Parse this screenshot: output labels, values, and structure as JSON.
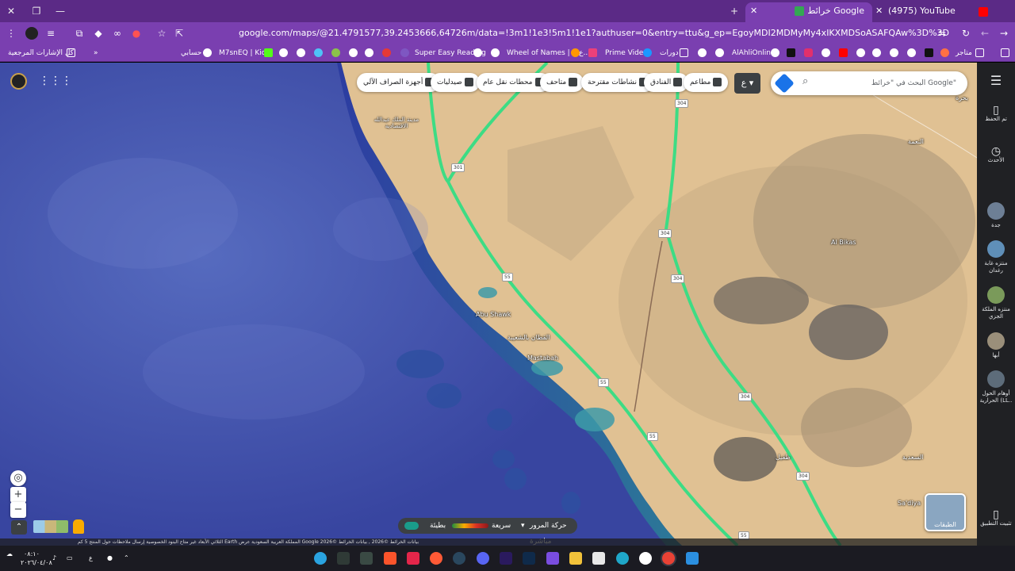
{
  "browser": {
    "tabs": [
      {
        "label": "خرائط Google",
        "active": true
      },
      {
        "label": "(4975) YouTube",
        "active": false
      }
    ],
    "url": "google.com/maps/@21.4791577,39.2453666,64726m/data=!3m1!1e3!5m1!1e1?authuser=0&entry=ttu&g_ep=EgoyMDI2MDMyMy4xIKXMDSoASAFQAw%3D%3D",
    "bookmarks": [
      {
        "label": "كل الإشارات المرجعية"
      },
      {
        "label": "حسابي"
      },
      {
        "label": "M7snEQ | Kick"
      },
      {
        "label": "Super Easy Reading"
      },
      {
        "label": "Wheel of Names | ...ع..."
      },
      {
        "label": "Prime Video"
      },
      {
        "label": "دورات"
      },
      {
        "label": "AlAhliOnline"
      },
      {
        "label": "متاجر"
      }
    ]
  },
  "maps": {
    "search_placeholder": "البحث في \"خرائط Google\"",
    "chips": [
      {
        "label": "مطاعم",
        "icon": "fork-knife-icon"
      },
      {
        "label": "الفنادق",
        "icon": "bed-icon"
      },
      {
        "label": "نشاطات مقترحة",
        "icon": "camera-icon"
      },
      {
        "label": "متاحف",
        "icon": "museum-icon"
      },
      {
        "label": "محطات نقل عام",
        "icon": "train-icon"
      },
      {
        "label": "صيدليات",
        "icon": "pharmacy-icon"
      },
      {
        "label": "أجهزة الصراف الآلي",
        "icon": "atm-icon"
      }
    ],
    "layer_chip": "ع",
    "traffic": {
      "mode": "حركة المرور مباشرة",
      "fast": "سريعة",
      "slow": "بطيئة"
    },
    "layers_label": "الطبقات",
    "labels": {
      "abu_shawk": "Abu Shawk",
      "mastabah": "Mastabah",
      "qitan": "القطان بالشعيبة",
      "al_bikas": "Al Bikas",
      "sadiya": "Sa'diya",
      "saadiya_ar": "السعدية",
      "tufail": "طفيل",
      "nama": "النعمة",
      "jeddah_city": "مدينة الملك عبدالله الاقتصادية",
      "top_right": "بحرة"
    },
    "road_shields": [
      "301",
      "304",
      "304",
      "304",
      "55",
      "55",
      "55",
      "55",
      "304",
      "304"
    ],
    "attribution": "بيانات الخرائط ©2026 , بيانات الخرائط ©2026 Google   المملكة العربية السعودية   عرض Earth الثلاثي الأبعاد غير متاح   البنود   الخصوصية   إرسال ملاحظات حول المنتج   5 كم"
  },
  "rail": [
    {
      "label": "تم الحفظ",
      "icon": "bookmark-icon"
    },
    {
      "label": "الأحدث",
      "icon": "history-icon"
    },
    {
      "label": "جدة",
      "icon": "place-thumb"
    },
    {
      "label": "منتزه غابة رغدان",
      "icon": "place-thumb"
    },
    {
      "label": "منتزه الملكة الجزي",
      "icon": "place-thumb"
    },
    {
      "label": "أبها",
      "icon": "place-thumb"
    },
    {
      "label": "أوهام الحول الحرارية (LL..",
      "icon": "place-thumb"
    },
    {
      "label": "تثبيت التطبيق",
      "icon": "phone-icon"
    }
  ],
  "taskbar": {
    "time": "٠٨:١٠",
    "date": "٢٠٢٦/٠٤/٠٨",
    "lang": "ع"
  },
  "colors": {
    "tab_bg": "#5b2a86",
    "toolbar_bg": "#7a3fb0",
    "sea": "#3c4aa8",
    "desert": "#e2c49a",
    "highway": "#3ddc84",
    "rail_bg": "#202124"
  }
}
